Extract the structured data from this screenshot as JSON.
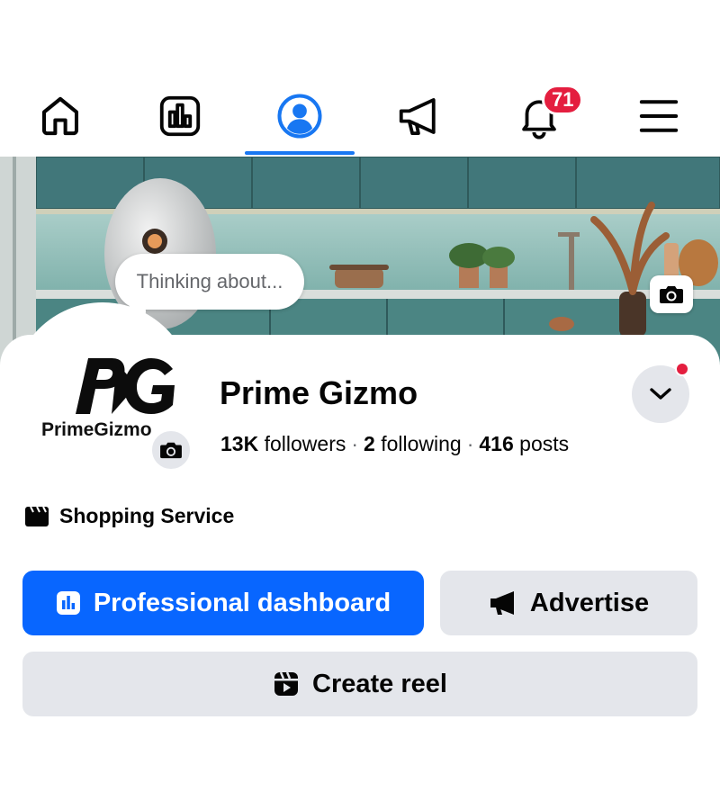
{
  "nav": {
    "items": [
      {
        "icon": "home-icon"
      },
      {
        "icon": "dashboard-icon"
      },
      {
        "icon": "profile-icon",
        "active": true
      },
      {
        "icon": "megaphone-icon"
      },
      {
        "icon": "bell-icon",
        "badge": "71"
      },
      {
        "icon": "menu-icon"
      }
    ],
    "active_color": "#1877f2"
  },
  "cover": {
    "thought_bubble": "Thinking about..."
  },
  "profile": {
    "avatar_logo_text": "PG",
    "avatar_wordmark": "PrimeGizmo",
    "name": "Prime Gizmo",
    "followers_count": "13K",
    "followers_label": "followers",
    "following_count": "2",
    "following_label": "following",
    "posts_count": "416",
    "posts_label": "posts",
    "separator": "·",
    "category": "Shopping Service"
  },
  "actions": {
    "professional_dashboard": "Professional dashboard",
    "advertise": "Advertise",
    "create_reel": "Create reel"
  },
  "colors": {
    "primary_button": "#0866ff",
    "secondary_button": "#e4e6eb",
    "badge": "#e41e3f"
  }
}
